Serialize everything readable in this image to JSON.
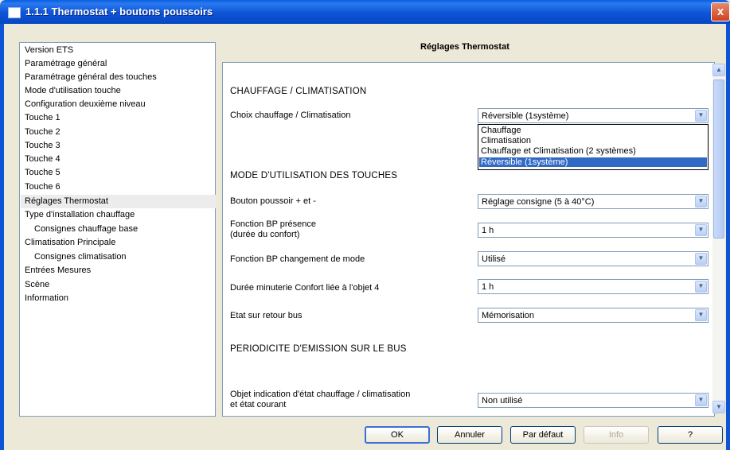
{
  "window": {
    "title": "1.1.1 Thermostat + boutons poussoirs",
    "close_label": "x"
  },
  "tree": {
    "items": [
      {
        "label": "Version ETS"
      },
      {
        "label": "Paramétrage général"
      },
      {
        "label": "Paramétrage général des touches"
      },
      {
        "label": "Mode d'utilisation touche"
      },
      {
        "label": "Configuration deuxième niveau"
      },
      {
        "label": "Touche 1"
      },
      {
        "label": "Touche 2"
      },
      {
        "label": "Touche 3"
      },
      {
        "label": "Touche 4"
      },
      {
        "label": "Touche 5"
      },
      {
        "label": "Touche 6"
      },
      {
        "label": "Réglages Thermostat"
      },
      {
        "label": "Type d'installation chauffage"
      },
      {
        "label": "Consignes chauffage base"
      },
      {
        "label": "Climatisation Principale"
      },
      {
        "label": "Consignes climatisation"
      },
      {
        "label": "Entrées Mesures"
      },
      {
        "label": "Scène"
      },
      {
        "label": "Information"
      }
    ]
  },
  "panel": {
    "title": "Réglages Thermostat",
    "section_heating": "CHAUFFAGE / CLIMATISATION",
    "section_buttons": "MODE D'UTILISATION DES TOUCHES",
    "section_emission": "PERIODICITE D'EMISSION SUR LE BUS",
    "fields": {
      "choix": {
        "label": "Choix chauffage / Climatisation",
        "value": "Réversible (1système)"
      },
      "bouton": {
        "label": "Bouton poussoir + et -",
        "value": "Réglage consigne (5 à 40°C)"
      },
      "presence": {
        "label_line1": "Fonction BP présence",
        "label_line2": "(durée du confort)",
        "value": "1 h"
      },
      "changement": {
        "label": "Fonction BP changement de mode",
        "value": "Utilisé"
      },
      "minuterie": {
        "label": "Durée minuterie Confort liée à l'objet 4",
        "value": "1 h"
      },
      "retour": {
        "label": "Etat sur retour bus",
        "value": "Mémorisation"
      },
      "indication": {
        "label_line1": "Objet indication d'état chauffage / climatisation",
        "label_line2": "et état courant",
        "value": "Non utilisé"
      }
    },
    "dropdown_options": [
      "Chauffage",
      "Climatisation",
      "Chauffage et Climatisation (2 systèmes)",
      "Réversible (1système)"
    ]
  },
  "buttons": {
    "ok": "OK",
    "annuler": "Annuler",
    "par_defaut": "Par défaut",
    "info": "Info",
    "help": "?"
  }
}
